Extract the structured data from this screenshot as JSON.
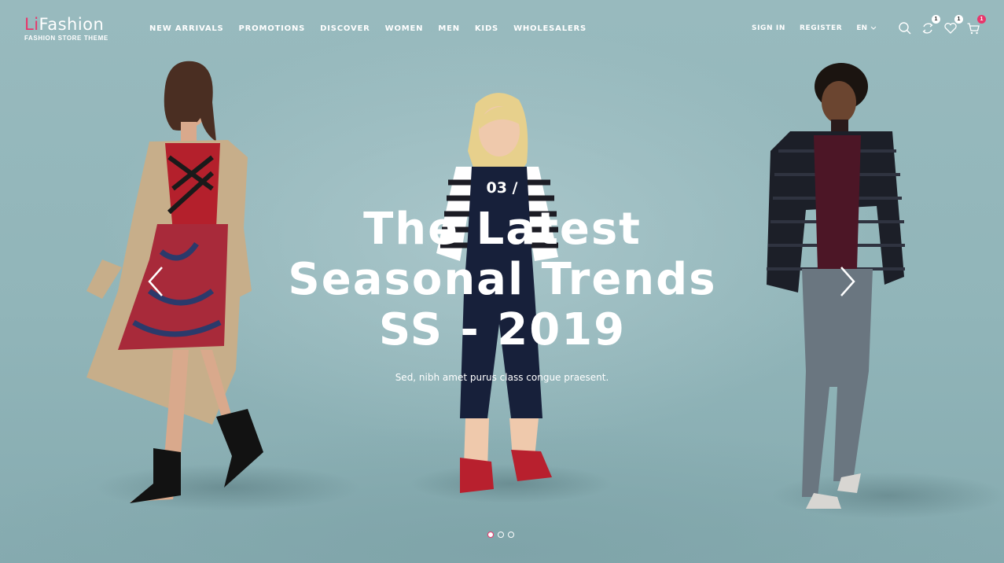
{
  "brand": {
    "logo_accent": "Li",
    "logo_rest": "Fashion",
    "tagline": "FASHION STORE THEME",
    "accent_color": "#e8366b"
  },
  "nav": {
    "items": [
      {
        "label": "NEW ARRIVALS"
      },
      {
        "label": "PROMOTIONS"
      },
      {
        "label": "DISCOVER"
      },
      {
        "label": "WOMEN"
      },
      {
        "label": "MEN"
      },
      {
        "label": "KIDS"
      },
      {
        "label": "WHOLESALERS"
      }
    ]
  },
  "account": {
    "sign_in": "SIGN IN",
    "register": "REGISTER",
    "language": "EN"
  },
  "icons": {
    "search": "search-icon",
    "compare": {
      "name": "compare-icon",
      "count": "1"
    },
    "wishlist": {
      "name": "heart-icon",
      "count": "1"
    },
    "cart": {
      "name": "cart-icon",
      "count": "1"
    }
  },
  "slide": {
    "counter": "03 /",
    "headline": [
      "The Latest",
      "Seasonal Trends",
      "SS - 2019"
    ],
    "subtitle": "Sed, nibh amet purus class congue praesent.",
    "current_index": 1,
    "total": 3
  }
}
